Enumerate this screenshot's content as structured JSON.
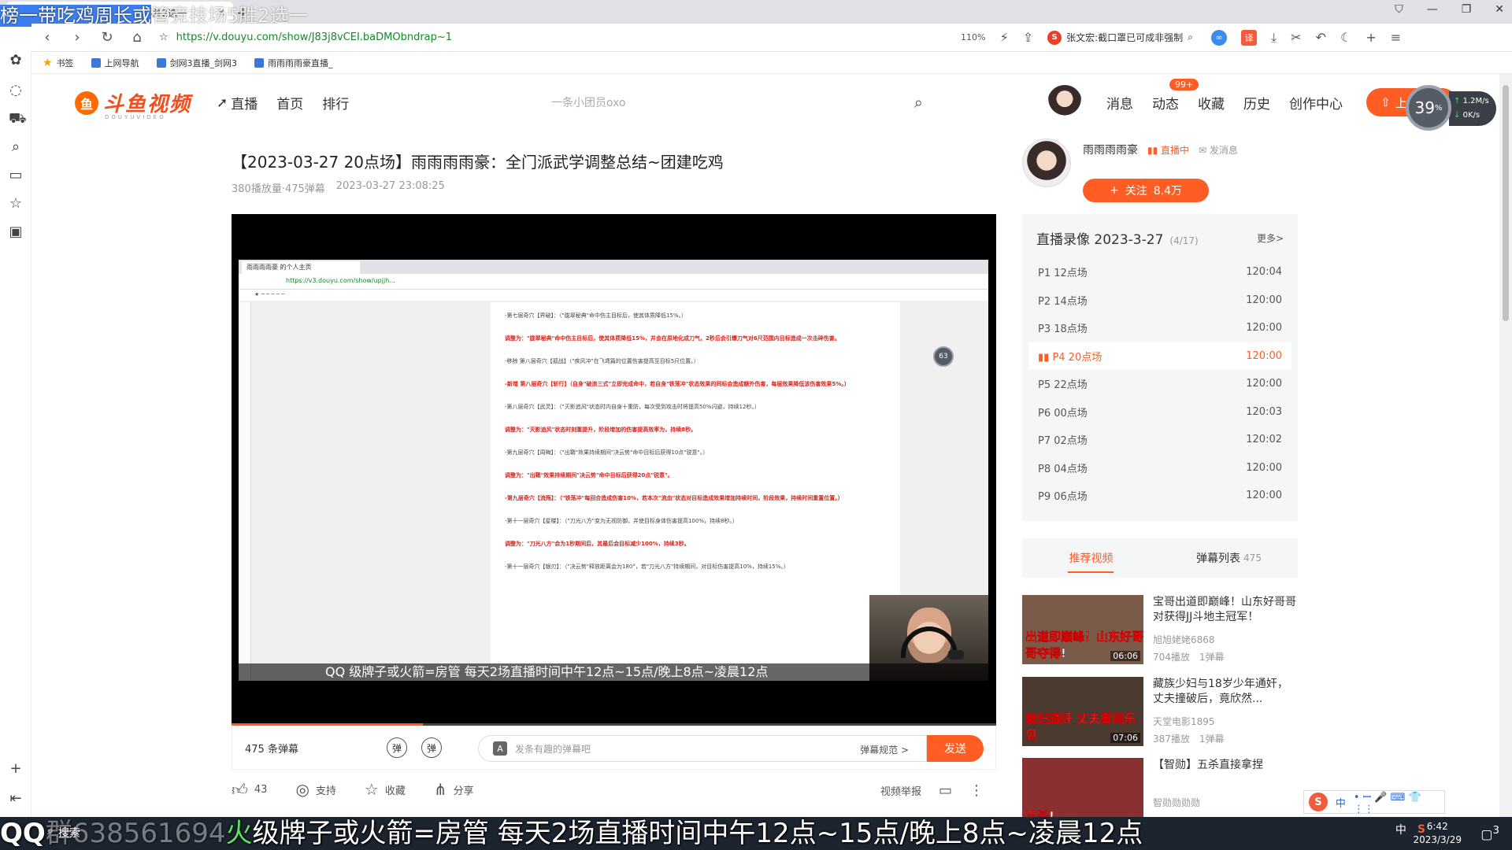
{
  "browser": {
    "tab_title": "榜一带吃鸡周长或管竞技场5胜2选一",
    "new_tab": "+",
    "url": "https://v.douyu.com/show/J83j8vCEI.baDMObndrap~1",
    "zoom": "110%",
    "search_text": "张文宏:截口罩已可成非强制",
    "window_controls": [
      "⛉",
      "—",
      "❐",
      "✕"
    ],
    "bookmarks": [
      "书签",
      "上网导航",
      "剑网3直播_剑网3",
      "雨雨雨雨豪直播_"
    ]
  },
  "overlay_top": {
    "highlight": "榜一带吃鸡周长或",
    "rest": "管竞技场5胜2选一"
  },
  "site": {
    "logo_text": "斗鱼视频",
    "logo_sub": "DOUYUVIDEO",
    "nav": [
      "直播",
      "首页",
      "排行"
    ],
    "search_placeholder": "一条小团员oxo",
    "header_links": [
      "消息",
      "动态",
      "收藏",
      "历史",
      "创作中心"
    ],
    "badge": "99+",
    "upload_label": "上传视频",
    "speed_percent": "39",
    "speed_unit": "%",
    "speed_up": "1.2",
    "speed_down": "0",
    "speed_unit_label": "K/s"
  },
  "video": {
    "title": "【2023-03-27 20点场】雨雨雨雨豪：全门派武学调整总结~团建吃鸡",
    "plays": "380播放量·475弹幕",
    "date": "2023-03-27 23:08:25",
    "progress": 0.25,
    "inner_tab": "雨雨雨雨豪 的个人主页",
    "inner_url": "https://v3.douyu.com/show/upjjh...",
    "inner_ball": "63",
    "inner_ticker": "QQ 级牌子或火箭=房管 每天2场直播时间中午12点~15点/晚上8点~凌晨12点",
    "doc_lines": [
      {
        "text": "-第七层奇穴【界破】：（\"胧翠秘典\"命中伤主目标后，使其体质降低15%。）",
        "red": false
      },
      {
        "text": "调整为：\"胧翠秘典\"命中伤主目标后，使其体质降低15%，并会在原地化成刀气，2秒后会引爆刀气对6尺范围内目标造成一次击碎伤害。",
        "red": true
      },
      {
        "text": "-移除 第八层奇穴【孤战】（\"疾风冲\"在飞鸢篇的位置伤害提高至目标5尺位置。）",
        "red": false
      },
      {
        "text": "-新增 第八层奇穴【斩行】（自身\"破浪三式\"立即完成命中，若自身\"铁荡冲\"状态效果的同标会造成额外伤害，每层效果降低该伤害效果5%。）",
        "red": true
      },
      {
        "text": "-第八层奇穴【武灵】：（\"灭影追风\"状态时内自身十重防，每次受到攻击时将提高50%闪避，持续12秒。）",
        "red": false
      },
      {
        "text": "调整为：\"灭影追风\"状态时刻重提升，阶段增加的伤害提高效率为，持续8秒。",
        "red": true
      },
      {
        "text": "-第九层奇穴【周梅】：（\"出鞘\"效果持续期间\"决云势\"命中目标后获得10点\"锐意\"。）",
        "red": false
      },
      {
        "text": "调整为：\"出鞘\"效果持续期间\"决云势\"命中目标后获得20点\"锐意\"。",
        "red": true
      },
      {
        "text": "-第九层奇穴【流殇】：（\"铁荡冲\"每回合造成伤害10%，若本次\"流血\"状态对目标造成效果增加持续时间，阶段效果，持续时间重置位置。）",
        "red": true
      },
      {
        "text": "-第十一层奇穴【星楼】：（\"刀光八方\"变为无视防御，并使目标身体伤害提高100%，持续8秒。）",
        "red": false
      },
      {
        "text": "调整为：\"刀光八方\"会为1秒期间后，其最后会目标减少100%，持续3秒。",
        "red": true
      },
      {
        "text": "-第十一层奇穴【银刃】：（\"决云势\"释放距离会为180°，若\"刀光八方\"持续期间，对目标伤害提高10%，持续15%。）",
        "red": false
      }
    ]
  },
  "danmu_bar": {
    "count": "475 条弹幕",
    "toggle1": "弹",
    "toggle2": "弹",
    "placeholder": "发条有趣的弹幕吧",
    "a_icon": "A",
    "rules": "弹幕规范 >",
    "send": "发送"
  },
  "actions": {
    "like_count": "43",
    "support": "支持",
    "collect": "收藏",
    "share": "分享",
    "report": "视频举报"
  },
  "streamer": {
    "name": "雨雨雨雨豪",
    "status": "直播中",
    "message": "发消息",
    "follow": "关注",
    "followers": "8.4万"
  },
  "replay": {
    "title": "直播录像 2023-3-27",
    "count": "(4/17)",
    "more": "更多>",
    "episodes": [
      {
        "label": "P1 12点场",
        "duration": "120:04",
        "active": false
      },
      {
        "label": "P2 14点场",
        "duration": "120:00",
        "active": false
      },
      {
        "label": "P3 18点场",
        "duration": "120:00",
        "active": false
      },
      {
        "label": "P4 20点场",
        "duration": "120:00",
        "active": true
      },
      {
        "label": "P5 22点场",
        "duration": "120:00",
        "active": false
      },
      {
        "label": "P6 00点场",
        "duration": "120:03",
        "active": false
      },
      {
        "label": "P7 02点场",
        "duration": "120:02",
        "active": false
      },
      {
        "label": "P8 04点场",
        "duration": "120:00",
        "active": false
      },
      {
        "label": "P9 06点场",
        "duration": "120:00",
        "active": false
      }
    ]
  },
  "recommend": {
    "tab_recommend": "推荐视频",
    "tab_danmu": "弹幕列表",
    "tab_danmu_count": "475",
    "items": [
      {
        "title": "宝哥出道即巅峰！山东好哥哥对获得JJ斗地主冠军！",
        "author": "旭旭姥姥6868",
        "stats": "704播放　1弹幕",
        "caption": "出道即巅峰！山东好哥哥夺得!",
        "duration": "06:06",
        "color": "#7a5a48"
      },
      {
        "title": "藏族少妇与18岁少年通奸，丈夫撞破后，竟欣然...",
        "author": "天堂电影1895",
        "stats": "387播放　1弹幕",
        "caption": "媳妇通奸 丈夫喜闻乐见",
        "duration": "07:06",
        "color": "#4a3a30"
      },
      {
        "title": "【智勋】五杀直接拿捏",
        "author": "智勋勋勋勋",
        "stats": "",
        "caption": "五杀!",
        "duration": "",
        "color": "#8a3030"
      }
    ]
  },
  "ime": {
    "s": "S",
    "lang": "中",
    "items": "• ꟷ 🎤 ⌨ 👕 ⋮⋮"
  },
  "taskbar": {
    "search": "搜索",
    "ticker_qq": "QQ",
    "ticker_num": "群638561694",
    "ticker_green": "火",
    "ticker_rest": "级牌子或火箭=房管 每天2场直播时间中午12点~15点/晚上8点~凌晨12点",
    "tray": [
      "中",
      "S"
    ],
    "time": "6:42",
    "date": "2023/3/29",
    "notify": "3"
  }
}
